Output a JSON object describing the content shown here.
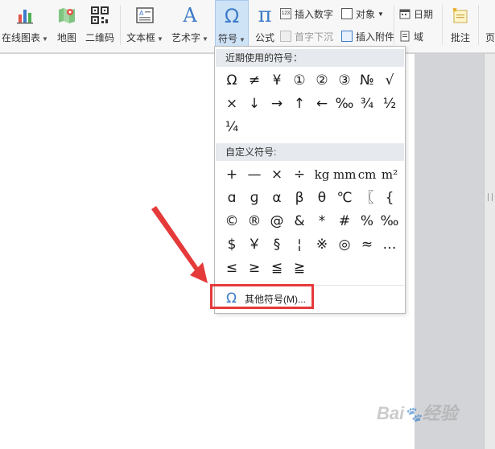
{
  "toolbar": {
    "buttons": [
      {
        "id": "online-chart",
        "label": "在线图表",
        "has_menu": true
      },
      {
        "id": "map",
        "label": "地图",
        "has_menu": false
      },
      {
        "id": "qrcode",
        "label": "二维码",
        "has_menu": false
      },
      {
        "id": "textbox",
        "label": "文本框",
        "has_menu": true
      },
      {
        "id": "wordart",
        "label": "艺术字",
        "has_menu": true
      },
      {
        "id": "symbol",
        "label": "符号",
        "has_menu": true
      },
      {
        "id": "formula",
        "label": "公式",
        "has_menu": false
      }
    ],
    "small_buttons": {
      "insert_number": "插入数字",
      "drop_cap": "首字下沉",
      "object": "对象",
      "insert_attachment": "插入附件",
      "date": "日期",
      "field": "域",
      "comment": "批注",
      "page_partial": "页"
    },
    "icon_text": {
      "wordart": "A",
      "symbol": "Ω",
      "formula": "π",
      "number_box": "123"
    }
  },
  "dropdown": {
    "recent_header": "近期使用的符号：",
    "recent_symbols": [
      "Ω",
      "≠",
      "¥",
      "①",
      "②",
      "③",
      "№",
      "√",
      "×",
      "↓",
      "→",
      "↑",
      "←",
      "‰",
      "¾",
      "½",
      "¼"
    ],
    "custom_header": "自定义符号:",
    "custom_symbols": [
      "+",
      "—",
      "×",
      "÷",
      "kg",
      "mm",
      "cm",
      "m²",
      "ɑ",
      "ɡ",
      "α",
      "β",
      "θ",
      "℃",
      "〖",
      "{",
      "©",
      "®",
      "@",
      "&",
      "*",
      "#",
      "%",
      "‰",
      "$",
      "￥",
      "§",
      "¦",
      "※",
      "◎",
      "≈",
      "…",
      "≤",
      "≥",
      "≦",
      "≧"
    ],
    "more_symbols_label": "其他符号(M)...",
    "more_symbols_icon": "Ω"
  },
  "watermark": {
    "text": "Bai",
    "text2": "经验"
  },
  "colors": {
    "highlight": "#e53a3a",
    "arrow": "#e53a3a",
    "accent": "#3d7cc9",
    "active_button_bg": "#cfe3f7"
  }
}
